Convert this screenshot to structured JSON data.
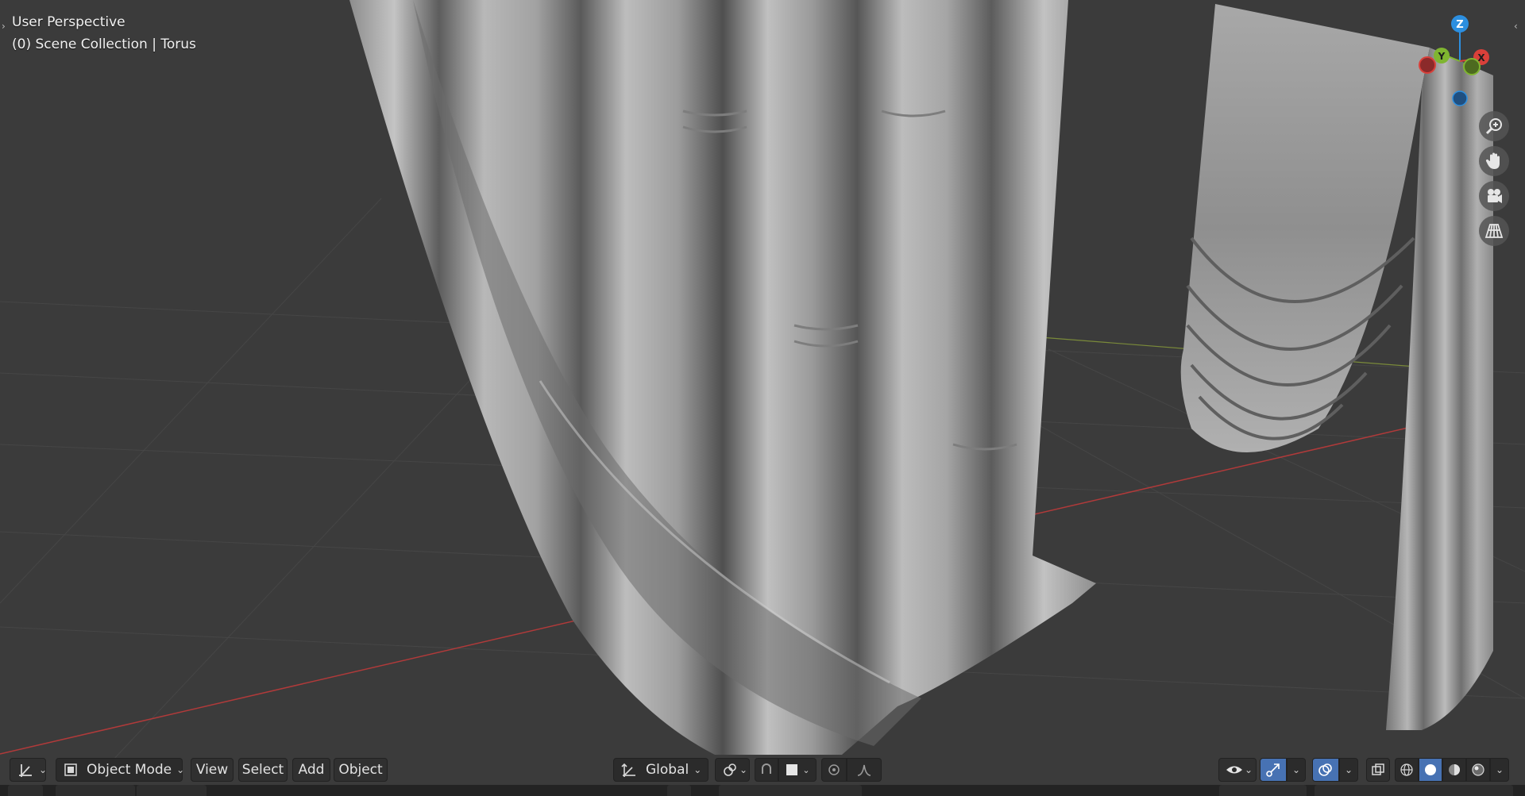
{
  "viewport": {
    "view_name": "User Perspective",
    "collection_info": "(0) Scene Collection | Torus",
    "background_color": "#3b3b3b",
    "cloth_color": "#a9a9a9",
    "x_axis_color": "#b03a3a",
    "y_axis_color": "#7a8a3a"
  },
  "gizmo": {
    "z_label": "Z",
    "y_label": "Y",
    "x_label": "X",
    "z_color": "#2c8fe0",
    "y_color": "#7fb530",
    "x_color": "#d9403a"
  },
  "navigation": {
    "buttons": [
      "zoom-icon",
      "hand-pan-icon",
      "camera-icon",
      "grid-perspective-icon"
    ]
  },
  "header": {
    "editor_type_icon": "axes-icon",
    "mode_label": "Object Mode",
    "menus": [
      "View",
      "Select",
      "Add",
      "Object"
    ],
    "orientation_label": "Global",
    "shading_active_index": 1,
    "accent_color": "#4772b3"
  }
}
